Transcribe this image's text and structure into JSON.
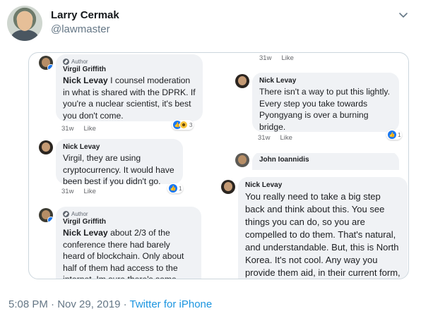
{
  "tweet": {
    "display_name": "Larry Cermak",
    "handle": "@lawmaster",
    "timestamp": "5:08 PM · Nov 29, 2019",
    "separator": " · ",
    "client": "Twitter for iPhone"
  },
  "comments": [
    {
      "author_tag": "Author",
      "name": "Virgil Griffith",
      "mention": "Nick Levay",
      "text": " I counsel moderation in what is shared with the DPRK. If you're a nuclear scientist, it's best you don't come.",
      "age": "31w",
      "like": "Like",
      "reaction_count": "3"
    },
    {
      "name": "Nick Levay",
      "text": "Virgil, they are using cryptocurrency. It would have been best if you didn't go.",
      "age": "31w",
      "like": "Like",
      "reaction_count": "1"
    },
    {
      "author_tag": "Author",
      "name": "Virgil Griffith",
      "mention": "Nick Levay",
      "text": " about 2/3 of the conference there had barely heard of blockchain.  Only about half of them had access to the internet. Im sure there's some crypto in the"
    },
    {
      "age": "31w",
      "like": "Like"
    },
    {
      "name": "Nick Levay",
      "text": "There isn't a way to put this lightly. Every step you take towards Pyongyang is over a burning bridge.",
      "age": "31w",
      "like": "Like",
      "reaction_count": "1"
    },
    {
      "name": "John Ioannidis"
    },
    {
      "name": "Nick Levay",
      "text": "You really need to take a big step back and think about this. You see things you can do, so you are compelled to do them. That's natural, and understandable. But, this is North Korea. It's not cool. Any way you provide them aid, in their current form, will follow you"
    }
  ]
}
